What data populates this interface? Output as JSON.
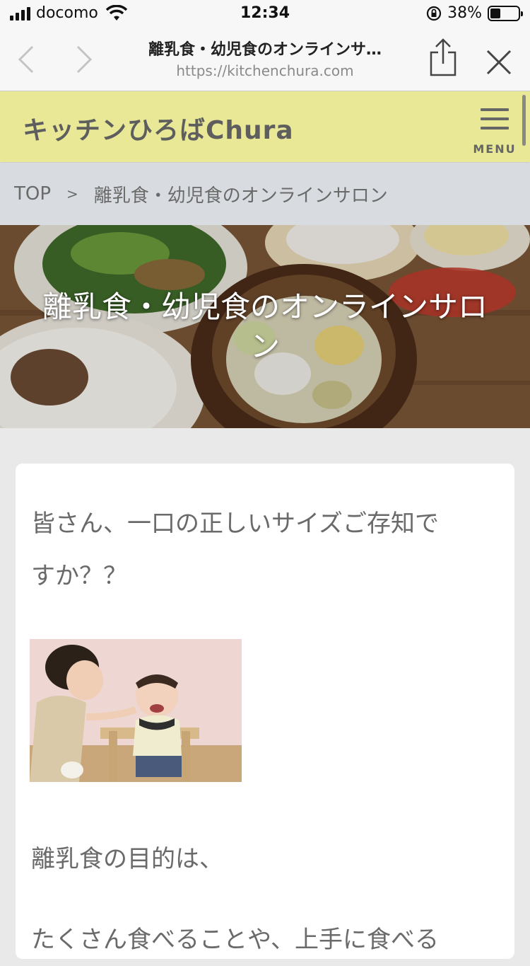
{
  "status_bar": {
    "carrier": "docomo",
    "time": "12:34",
    "battery_percent": "38%",
    "battery_level": 0.38
  },
  "browser": {
    "page_title": "離乳食・幼児食のオンラインサ…",
    "url": "https://kitchenchura.com"
  },
  "site": {
    "title": "キッチンひろばChura",
    "menu_label": "MENU"
  },
  "breadcrumb": {
    "items": [
      "TOP",
      "離乳食・幼児食のオンラインサロン"
    ],
    "separator": ">"
  },
  "hero": {
    "title_line1": "離乳食・幼児食のオンラインサロ",
    "title_line2": "ン"
  },
  "article": {
    "para1_line1": "皆さん、一口の正しいサイズご存知で",
    "para1_line2": "すか？？",
    "photo_icon": "mother-feeding-baby-photo",
    "para2": "離乳食の目的は、",
    "para3": "たくさん食べることや、上手に食べる"
  },
  "colors": {
    "header_bg": "#e9e897",
    "breadcrumb_bg": "#d8dce0",
    "page_bg": "#e9e9e9"
  }
}
